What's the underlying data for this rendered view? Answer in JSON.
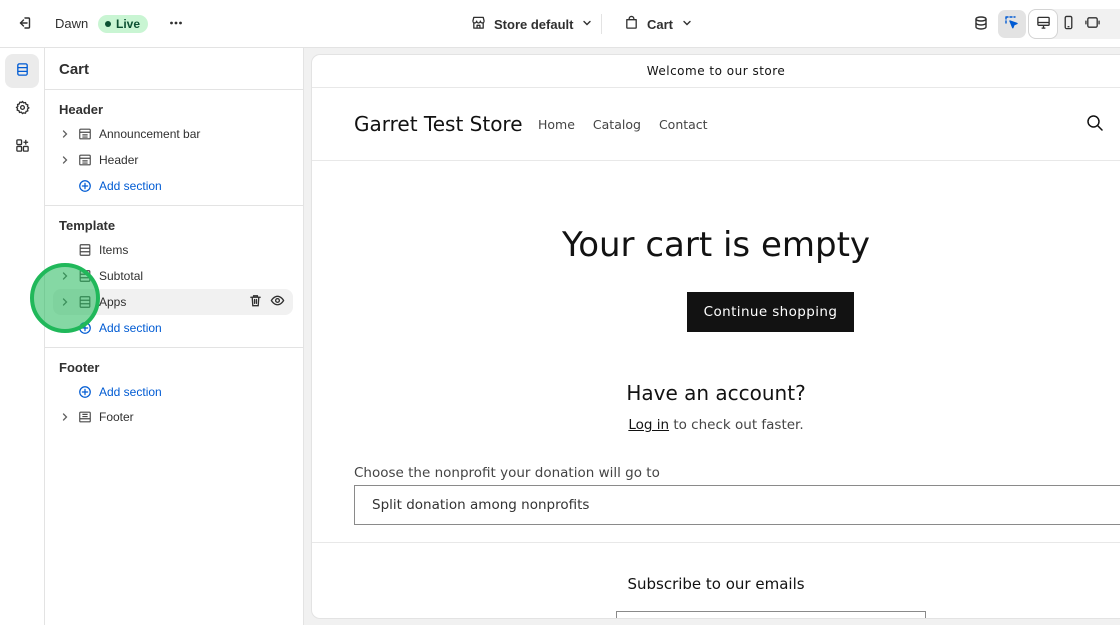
{
  "topbar": {
    "theme_name": "Dawn",
    "live_label": "Live",
    "store_selector": "Store default",
    "page_selector": "Cart"
  },
  "sidebar": {
    "title": "Cart",
    "groups": [
      {
        "title": "Header",
        "items": [
          {
            "label": "Announcement bar"
          },
          {
            "label": "Header"
          }
        ],
        "add_label": "Add section"
      },
      {
        "title": "Template",
        "items": [
          {
            "label": "Items"
          },
          {
            "label": "Subtotal"
          },
          {
            "label": "Apps"
          }
        ],
        "add_label": "Add section"
      },
      {
        "title": "Footer",
        "add_label": "Add section",
        "items": [
          {
            "label": "Footer"
          }
        ]
      }
    ]
  },
  "preview": {
    "announcement": "Welcome to our store",
    "store_name": "Garret Test Store",
    "nav": [
      "Home",
      "Catalog",
      "Contact"
    ],
    "cart_empty_title": "Your cart is empty",
    "cta_label": "Continue shopping",
    "account_title": "Have an account?",
    "login_link": "Log in",
    "login_suffix": " to check out faster.",
    "nonprofit_label": "Choose the nonprofit your donation will go to",
    "nonprofit_value": "Split donation among nonprofits",
    "subscribe_title": "Subscribe to our emails"
  },
  "colors": {
    "accent_link": "#005bd3",
    "live_badge_bg": "#c9f5d3",
    "highlight_ring": "#20b85a",
    "cta_bg": "#121212"
  }
}
